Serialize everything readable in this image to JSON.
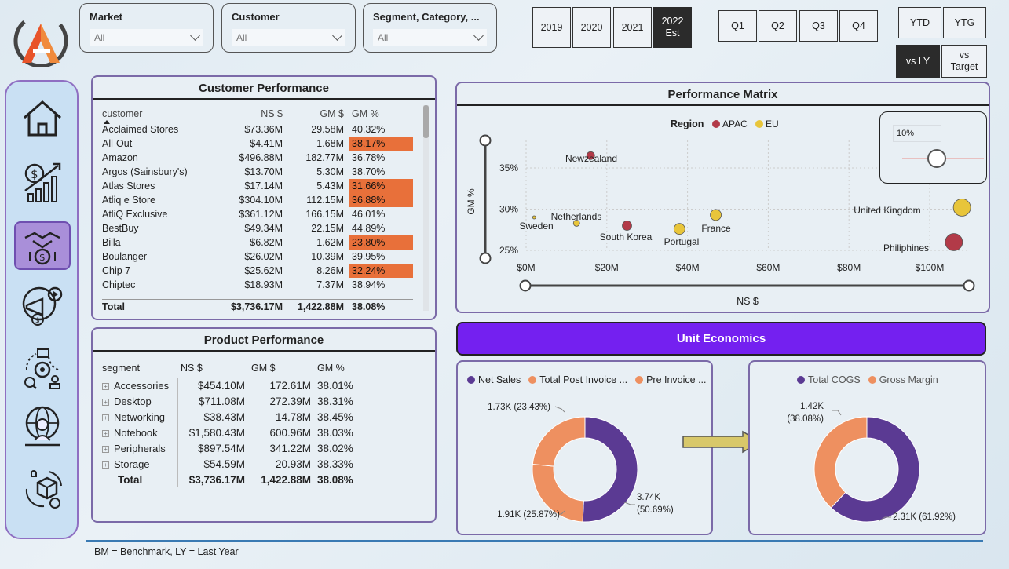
{
  "filters": [
    {
      "label": "Market",
      "value": "All"
    },
    {
      "label": "Customer",
      "value": "All"
    },
    {
      "label": "Segment, Category, ...",
      "value": "All"
    }
  ],
  "years": [
    "2019",
    "2020",
    "2021",
    "2022\nEst"
  ],
  "quarters": [
    "Q1",
    "Q2",
    "Q3",
    "Q4"
  ],
  "ytd": [
    "YTD",
    "YTG"
  ],
  "compare": [
    "vs LY",
    "vs\nTarget"
  ],
  "nav_icons": [
    "home-icon",
    "finance-icon",
    "sales-icon",
    "marketing-icon",
    "supply-chain-icon",
    "executive-icon",
    "support-icon"
  ],
  "customer_performance": {
    "title": "Customer Performance",
    "headers": [
      "customer",
      "NS $",
      "GM $",
      "GM %"
    ],
    "rows": [
      [
        "Acclaimed Stores",
        "$73.36M",
        "29.58M",
        "40.32%",
        false
      ],
      [
        "All-Out",
        "$4.41M",
        "1.68M",
        "38.17%",
        true
      ],
      [
        "Amazon",
        "$496.88M",
        "182.77M",
        "36.78%",
        false
      ],
      [
        "Argos (Sainsbury's)",
        "$13.70M",
        "5.30M",
        "38.70%",
        false
      ],
      [
        "Atlas Stores",
        "$17.14M",
        "5.43M",
        "31.66%",
        true
      ],
      [
        "Atliq e Store",
        "$304.10M",
        "112.15M",
        "36.88%",
        true
      ],
      [
        "AtliQ Exclusive",
        "$361.12M",
        "166.15M",
        "46.01%",
        false
      ],
      [
        "BestBuy",
        "$49.34M",
        "22.15M",
        "44.89%",
        false
      ],
      [
        "Billa",
        "$6.82M",
        "1.62M",
        "23.80%",
        true
      ],
      [
        "Boulanger",
        "$26.02M",
        "10.39M",
        "39.95%",
        false
      ],
      [
        "Chip 7",
        "$25.62M",
        "8.26M",
        "32.24%",
        true
      ],
      [
        "Chiptec",
        "$18.93M",
        "7.37M",
        "38.94%",
        false
      ]
    ],
    "total": [
      "Total",
      "$3,736.17M",
      "1,422.88M",
      "38.08%"
    ]
  },
  "product_performance": {
    "title": "Product Performance",
    "headers": [
      "segment",
      "NS $",
      "GM $",
      "GM %"
    ],
    "rows": [
      [
        "Accessories",
        "$454.10M",
        "172.61M",
        "38.01%"
      ],
      [
        "Desktop",
        "$711.08M",
        "272.39M",
        "38.31%"
      ],
      [
        "Networking",
        "$38.43M",
        "14.78M",
        "38.45%"
      ],
      [
        "Notebook",
        "$1,580.43M",
        "600.96M",
        "38.03%"
      ],
      [
        "Peripherals",
        "$897.54M",
        "341.22M",
        "38.02%"
      ],
      [
        "Storage",
        "$54.59M",
        "20.93M",
        "38.33%"
      ]
    ],
    "total": [
      "Total",
      "$3,736.17M",
      "1,422.88M",
      "38.08%"
    ]
  },
  "chart_data": [
    {
      "type": "scatter",
      "title": "Performance Matrix",
      "xlabel": "NS $",
      "ylabel": "GM %",
      "legend_title": "Region",
      "xlim": [
        0,
        110
      ],
      "ylim": [
        24,
        37
      ],
      "x_ticks": [
        "$0M",
        "$20M",
        "$40M",
        "$60M",
        "$80M",
        "$100M"
      ],
      "y_ticks": [
        "25%",
        "30%",
        "35%"
      ],
      "slicer_value": "10%",
      "colors": {
        "APAC": "#b23a48",
        "EU": "#e8c53a"
      },
      "series": [
        {
          "name": "APAC",
          "points": [
            {
              "label": "Newzealand",
              "x": 16,
              "y": 36.5,
              "size": 5
            },
            {
              "label": "South Korea",
              "x": 25,
              "y": 28,
              "size": 6
            },
            {
              "label": "Philiphines",
              "x": 106,
              "y": 26,
              "size": 11
            }
          ]
        },
        {
          "name": "EU",
          "points": [
            {
              "label": "Netherlands",
              "x": 12.5,
              "y": 28.3,
              "size": 4
            },
            {
              "label": "Sweden",
              "x": 2,
              "y": 29,
              "size": 2
            },
            {
              "label": "Portugal",
              "x": 38,
              "y": 27.6,
              "size": 7
            },
            {
              "label": "France",
              "x": 47,
              "y": 29.3,
              "size": 7
            },
            {
              "label": "United Kingdom",
              "x": 108,
              "y": 30.2,
              "size": 11
            }
          ]
        }
      ]
    },
    {
      "type": "pie",
      "legend": [
        "Net Sales",
        "Total Post Invoice ...",
        "Pre Invoice ..."
      ],
      "slices": [
        {
          "name": "Net Sales",
          "value": 3.74,
          "label": "3.74K\n(50.69%)",
          "pct": 50.69,
          "color": "#5b3a93"
        },
        {
          "name": "Total Post Invoice ...",
          "value": 1.91,
          "label": "1.91K (25.87%)",
          "pct": 25.87,
          "color": "#ee9060"
        },
        {
          "name": "Pre Invoice ...",
          "value": 1.73,
          "label": "1.73K (23.43%)",
          "pct": 23.43,
          "color": "#ee9060"
        }
      ]
    },
    {
      "type": "pie",
      "legend": [
        "Total COGS",
        "Gross Margin"
      ],
      "slices": [
        {
          "name": "Total COGS",
          "value": 2.31,
          "label": "2.31K (61.92%)",
          "pct": 61.92,
          "color": "#5b3a93"
        },
        {
          "name": "Gross Margin",
          "value": 1.42,
          "label": "1.42K\n(38.08%)",
          "pct": 38.08,
          "color": "#ee9060"
        }
      ]
    }
  ],
  "unit_economics_title": "Unit Economics",
  "footnote": "BM = Benchmark, LY = Last Year"
}
